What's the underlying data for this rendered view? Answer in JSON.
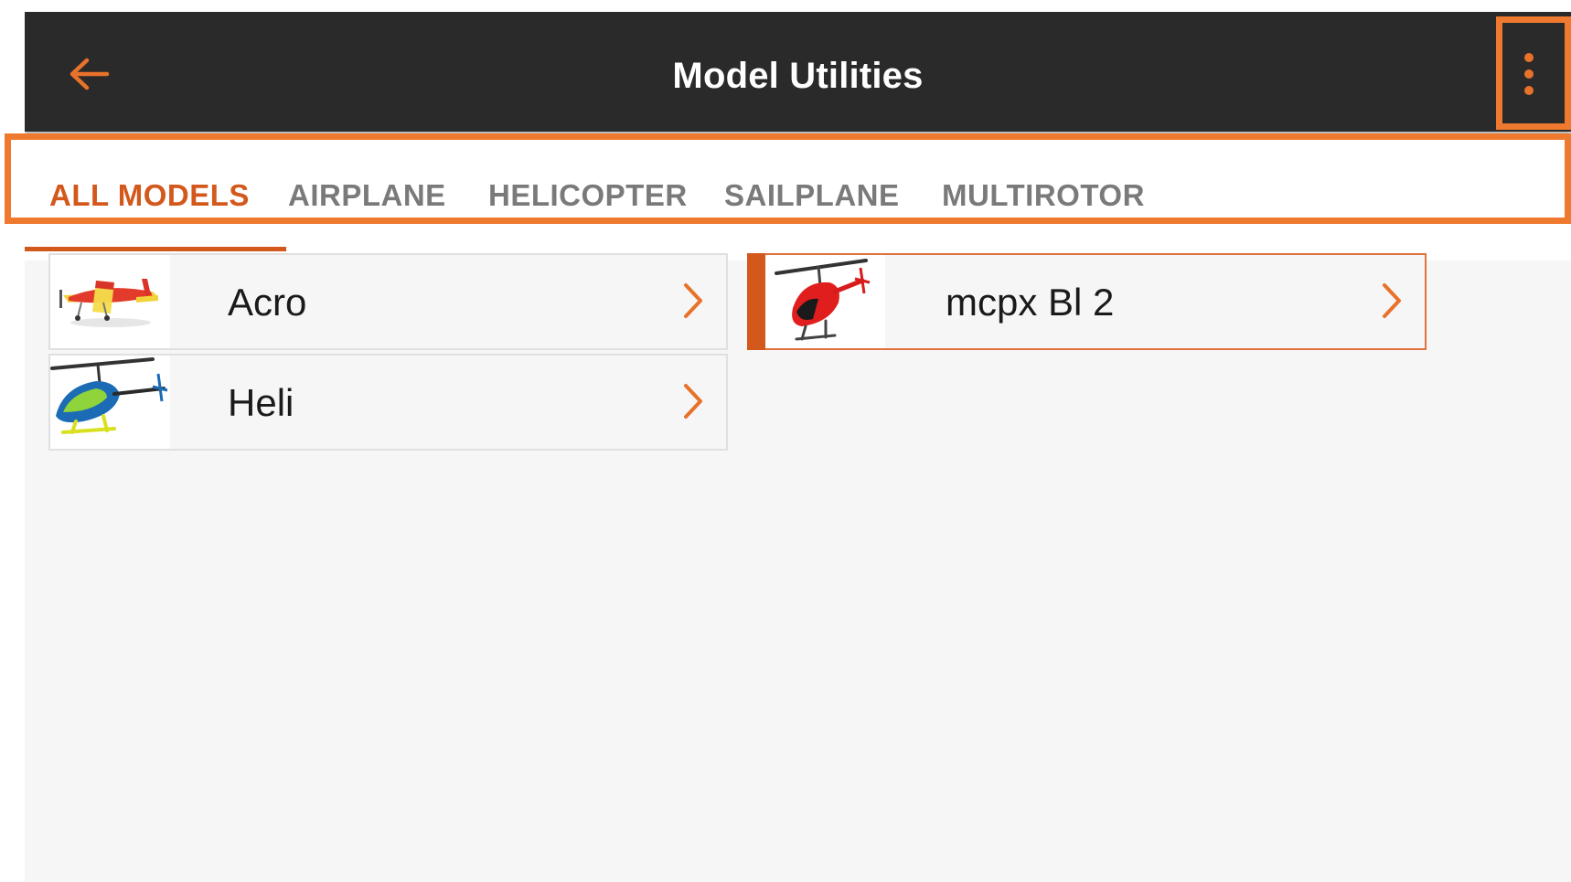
{
  "header": {
    "title": "Model Utilities"
  },
  "tabs": [
    {
      "label": "ALL MODELS",
      "active": true
    },
    {
      "label": "AIRPLANE",
      "active": false
    },
    {
      "label": "HELICOPTER",
      "active": false
    },
    {
      "label": "SAILPLANE",
      "active": false
    },
    {
      "label": "MULTIROTOR",
      "active": false
    }
  ],
  "models": [
    {
      "name": "Acro",
      "icon": "airplane-icon",
      "selected": false
    },
    {
      "name": "mcpx Bl 2",
      "icon": "helicopter-icon",
      "selected": true
    },
    {
      "name": "Heli",
      "icon": "helicopter-icon",
      "selected": false
    }
  ],
  "colors": {
    "accent": "#d3581c",
    "highlight": "#ef7a2f",
    "header_bg": "#2a2a2a",
    "content_bg": "#f6f6f6"
  }
}
